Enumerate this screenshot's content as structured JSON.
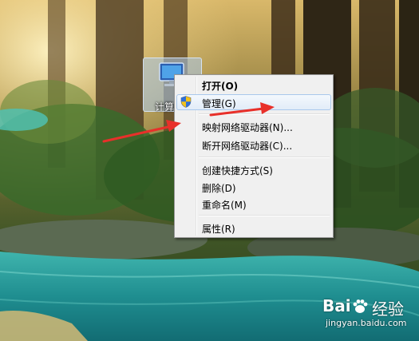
{
  "desktop": {
    "icon_label": "计算机"
  },
  "context_menu": {
    "items": [
      {
        "label": "打开(O)",
        "bold": true
      },
      {
        "label": "管理(G)",
        "icon": "uac-shield-icon",
        "hovered": true
      },
      {
        "label": "映射网络驱动器(N)..."
      },
      {
        "label": "断开网络驱动器(C)..."
      },
      {
        "label": "创建快捷方式(S)"
      },
      {
        "label": "删除(D)"
      },
      {
        "label": "重命名(M)"
      },
      {
        "label": "属性(R)"
      }
    ]
  },
  "annotation": {
    "arrow_color": "#e8302a"
  },
  "watermark": {
    "brand_before": "Bai",
    "brand_after": "经验",
    "url": "jingyan.baidu.com"
  }
}
